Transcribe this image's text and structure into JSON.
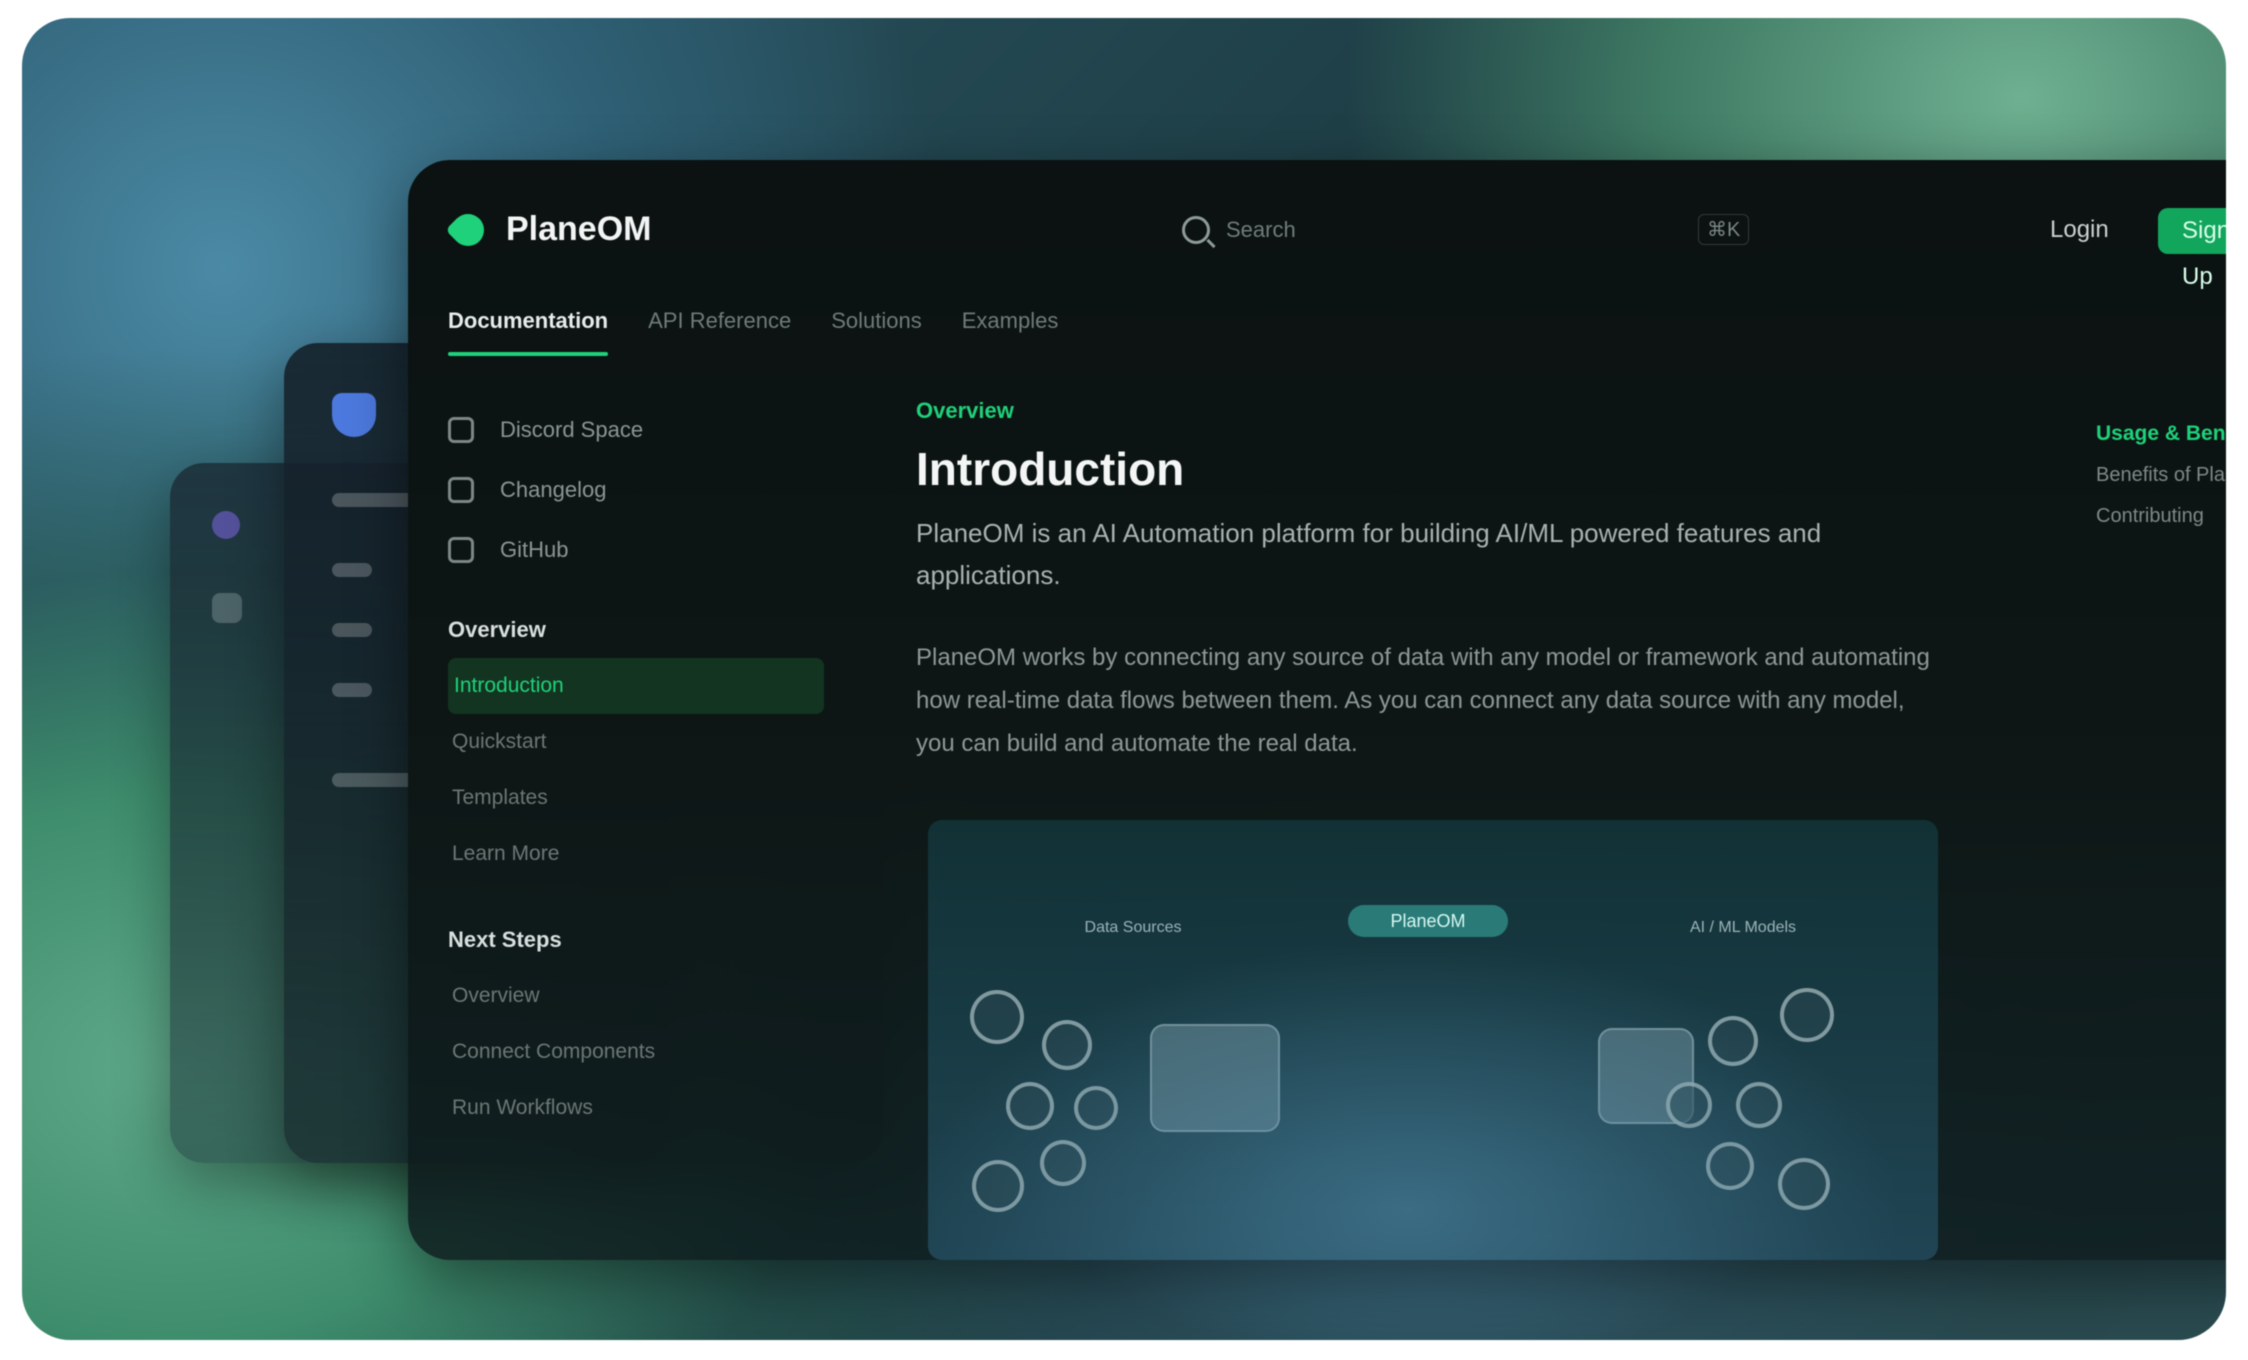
{
  "app": {
    "name": "PlaneOM",
    "accent": "#1fd17a",
    "search_placeholder": "Search",
    "shortcut": "⌘K",
    "login_label": "Login",
    "signup_label": "Sign Up"
  },
  "tabs": [
    "Documentation",
    "API Reference",
    "Solutions",
    "Examples"
  ],
  "sidebar": {
    "links": [
      {
        "label": "Discord Space",
        "icon": "discord-icon"
      },
      {
        "label": "Changelog",
        "icon": "rocket-icon"
      },
      {
        "label": "GitHub",
        "icon": "github-icon"
      }
    ],
    "sections": [
      {
        "title": "Overview",
        "items": [
          "Introduction",
          "Quickstart",
          "Templates",
          "Learn More"
        ]
      },
      {
        "title": "Next Steps",
        "items": [
          "Overview",
          "Connect Components",
          "Run Workflows"
        ]
      }
    ]
  },
  "content": {
    "kicker": "Overview",
    "title": "Introduction",
    "lead": "PlaneOM is an AI Automation platform for building AI/ML powered features and applications.",
    "body": "PlaneOM works by connecting any source of data with any model or framework and automating how real-time data flows between them. As you can connect any data source with any model, you can build and automate the real data."
  },
  "diagram": {
    "center_label": "PlaneOM",
    "left_group": "Data Sources",
    "right_group": "AI / ML Models"
  },
  "toc": {
    "head": "Usage & Benefits",
    "items": [
      "Benefits of PlaneOM",
      "Contributing"
    ]
  }
}
